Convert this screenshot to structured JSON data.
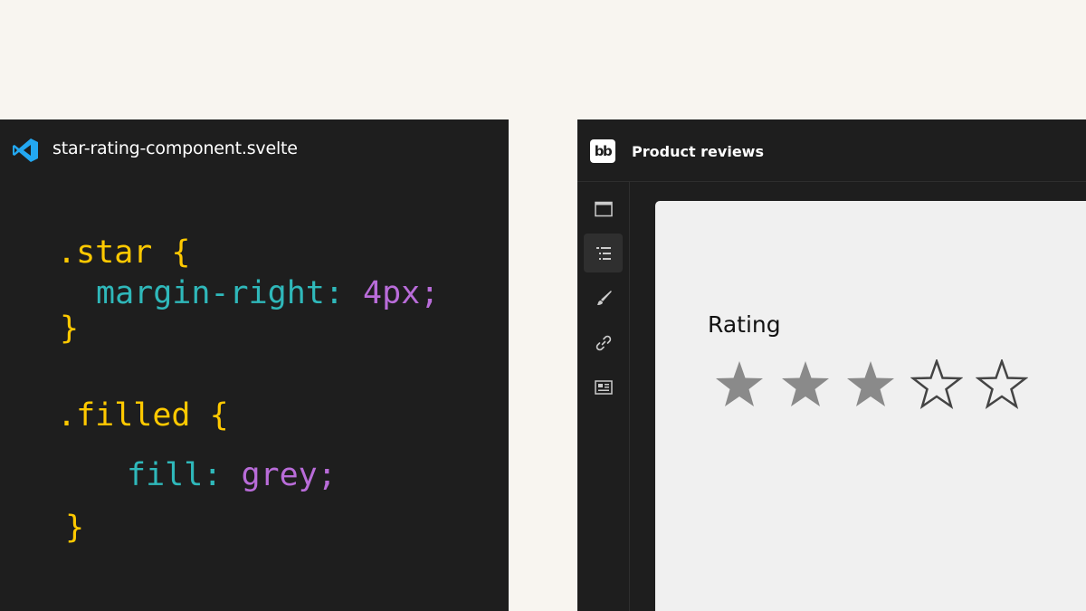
{
  "editor": {
    "filename": "star-rating-component.svelte",
    "icon": "vscode-icon",
    "code": {
      "star_selector": ".star {",
      "star_property": "margin-right:",
      "star_value": "4px;",
      "star_close": "}",
      "filled_selector": ".filled {",
      "filled_property": "fill:",
      "filled_value": "grey;",
      "filled_close": "}"
    }
  },
  "app": {
    "logo": "bb",
    "title": "Product reviews",
    "sidebar_icons": [
      "screen-icon",
      "list-icon",
      "brush-icon",
      "link-icon",
      "layout-icon"
    ],
    "active_sidebar_index": 1,
    "component": {
      "label": "Rating",
      "rating": 3,
      "max_rating": 5
    }
  },
  "colors": {
    "background": "#f8f5f0",
    "panel": "#1e1e1e",
    "code_selector": "#ffc900",
    "code_property": "#2fb8ba",
    "code_value": "#b96cd9",
    "star_filled": "#8a8a8a",
    "star_outline": "#444444"
  }
}
